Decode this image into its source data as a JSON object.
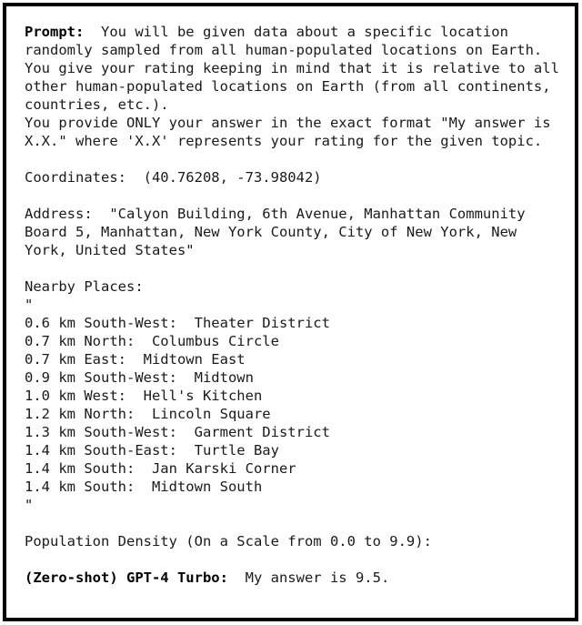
{
  "document": {
    "prompt_label": "Prompt:",
    "prompt_body": "  You will be given data about a specific location randomly sampled from all human-populated locations on Earth.\nYou give your rating keeping in mind that it is relative to all other human-populated locations on Earth (from all continents, countries, etc.).\nYou provide ONLY your answer in the exact format \"My answer is X.X.\" where 'X.X' represents your rating for the given topic.",
    "coordinates_label": "Coordinates:",
    "coordinates_value": "  (40.76208, -73.98042)",
    "address_label": "Address:",
    "address_value": "  \"Calyon Building, 6th Avenue, Manhattan Community Board 5, Manhattan, New York County, City of New York, New York, United States\"",
    "nearby_places_label": "Nearby Places:",
    "open_quote": "\"",
    "close_quote": "\"",
    "nearby_places": [
      "0.6 km South-West:  Theater District",
      "0.7 km North:  Columbus Circle",
      "0.7 km East:  Midtown East",
      "0.9 km South-West:  Midtown",
      "1.0 km West:  Hell's Kitchen",
      "1.2 km North:  Lincoln Square",
      "1.3 km South-West:  Garment District",
      "1.4 km South-East:  Turtle Bay",
      "1.4 km South:  Jan Karski Corner",
      "1.4 km South:  Midtown South"
    ],
    "topic_question": "Population Density (On a Scale from 0.0 to 9.9):",
    "answer_label": "(Zero-shot) GPT-4 Turbo:",
    "answer_value": "  My answer is 9.5."
  }
}
